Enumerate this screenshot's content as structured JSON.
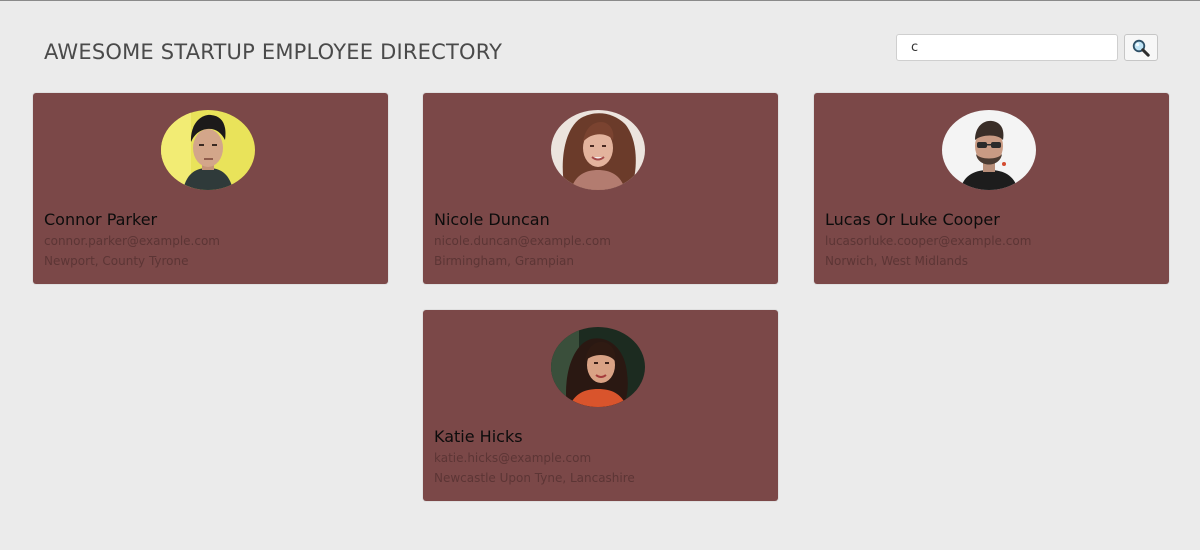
{
  "header": {
    "title": "AWESOME STARTUP EMPLOYEE DIRECTORY"
  },
  "search": {
    "value": "c",
    "button_icon": "magnifier-icon"
  },
  "colors": {
    "background": "#ebebeb",
    "card": "#7b4848",
    "name_text": "#0c0c0c",
    "detail_text": "#5c3535"
  },
  "employees": [
    {
      "name": "Connor Parker",
      "email": "connor.parker@example.com",
      "location": "Newport, County Tyrone"
    },
    {
      "name": "Nicole Duncan",
      "email": "nicole.duncan@example.com",
      "location": "Birmingham, Grampian"
    },
    {
      "name": "Lucas Or Luke Cooper",
      "email": "lucasorluke.cooper@example.com",
      "location": "Norwich, West Midlands"
    },
    {
      "name": "Katie Hicks",
      "email": "katie.hicks@example.com",
      "location": "Newcastle Upon Tyne, Lancashire"
    }
  ]
}
